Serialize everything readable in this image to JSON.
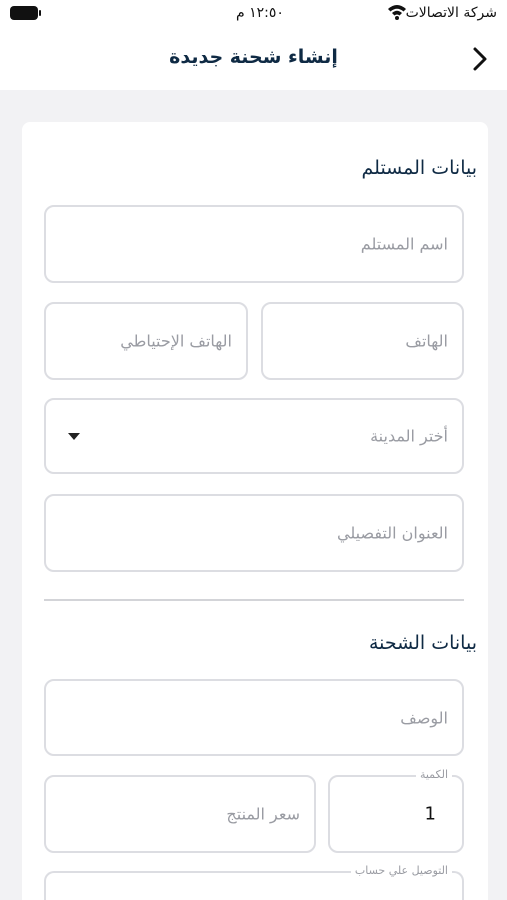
{
  "status_bar": {
    "carrier": "شركة الاتصالات",
    "time": "١٢:٥٠ م"
  },
  "header": {
    "title": "إنشاء شحنة جديدة"
  },
  "recipient": {
    "section_title": "بيانات المستلم",
    "name_placeholder": "اسم المستلم",
    "phone_placeholder": "الهاتف",
    "backup_phone_placeholder": "الهاتف الإحتياطي",
    "city_placeholder": "أختر المدينة",
    "address_placeholder": "العنوان التفصيلي"
  },
  "shipment": {
    "section_title": "بيانات الشحنة",
    "description_placeholder": "الوصف",
    "quantity_label": "الكمية",
    "quantity_value": "1",
    "price_placeholder": "سعر المنتج",
    "delivery_account_label": "التوصيل علي حساب"
  }
}
